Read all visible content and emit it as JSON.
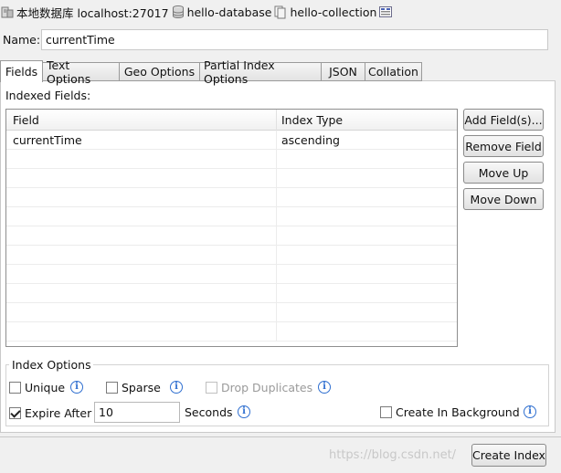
{
  "breadcrumb": [
    {
      "label": "本地数据库 localhost:27017",
      "icon": "server-icon"
    },
    {
      "label": "hello-database",
      "icon": "database-icon"
    },
    {
      "label": "hello-collection",
      "icon": "collection-icon"
    }
  ],
  "name_field": {
    "label": "Name:",
    "value": "currentTime"
  },
  "tabs": [
    {
      "label": "Fields",
      "active": true
    },
    {
      "label": "Text Options"
    },
    {
      "label": "Geo Options"
    },
    {
      "label": "Partial Index Options"
    },
    {
      "label": "JSON"
    },
    {
      "label": "Collation"
    }
  ],
  "indexed_fields": {
    "label": "Indexed Fields:",
    "columns": [
      "Field",
      "Index Type"
    ],
    "rows": [
      {
        "field": "currentTime",
        "type": "ascending"
      }
    ]
  },
  "side_buttons": {
    "add": "Add Field(s)...",
    "remove": "Remove Field",
    "up": "Move Up",
    "down": "Move Down"
  },
  "index_options": {
    "title": "Index Options",
    "unique": {
      "label": "Unique",
      "checked": false
    },
    "sparse": {
      "label": "Sparse",
      "checked": false
    },
    "drop_duplicates": {
      "label": "Drop Duplicates",
      "checked": false,
      "disabled": true
    },
    "expire_after": {
      "label": "Expire After",
      "checked": true,
      "value": "10",
      "unit": "Seconds"
    },
    "background": {
      "label": "Create In Background",
      "checked": false
    }
  },
  "footer": {
    "create_button": "Create Index",
    "watermark": "https://blog.csdn.net/"
  },
  "colors": {
    "info_icon": "#2f6fd0",
    "panel_bg": "#ffffff",
    "window_bg": "#f0f0f0"
  }
}
